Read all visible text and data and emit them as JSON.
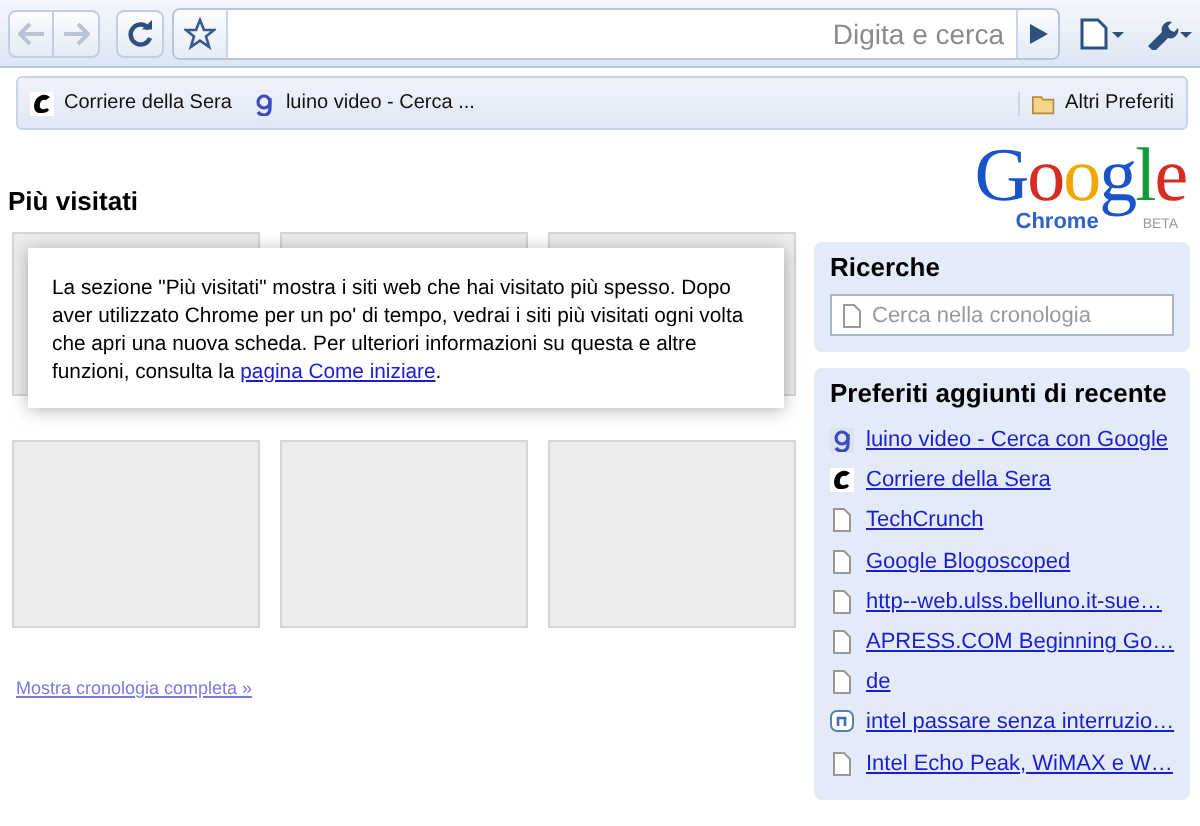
{
  "toolbar": {
    "back_disabled": true,
    "forward_disabled": true,
    "omnibox_placeholder": "Digita e cerca"
  },
  "bookmarks_bar": {
    "items": [
      {
        "label": "Corriere della Sera",
        "kind": "corriere"
      },
      {
        "label": "luino video - Cerca ...",
        "kind": "google"
      }
    ],
    "other": "Altri Preferiti"
  },
  "most_visited": {
    "title": "Più visitati",
    "notice": "La sezione \"Più visitati\" mostra i siti web che hai visitato più spesso. Dopo aver utilizzato Chrome per un po' di tempo, vedrai i siti più visitati ogni volta che apri una nuova scheda. Per ulteriori informazioni su questa e altre funzioni, consulta la",
    "notice_link": "pagina Come iniziare",
    "notice_end": ".",
    "history_link": "Mostra cronologia completa »"
  },
  "logo": {
    "word": "Google",
    "product": "Chrome",
    "badge": "BETA"
  },
  "searches": {
    "title": "Ricerche",
    "placeholder": "Cerca nella cronologia"
  },
  "recent_bookmarks": {
    "title": "Preferiti aggiunti di recente",
    "items": [
      {
        "label": "luino video - Cerca con Google",
        "kind": "google"
      },
      {
        "label": "Corriere della Sera",
        "kind": "corriere"
      },
      {
        "label": "TechCrunch",
        "kind": "page"
      },
      {
        "label": "Google Blogoscoped",
        "kind": "page"
      },
      {
        "label": "http--web.ulss.belluno.it-sue…",
        "kind": "page"
      },
      {
        "label": "APRESS.COM Beginning Go…",
        "kind": "page"
      },
      {
        "label": "de",
        "kind": "page"
      },
      {
        "label": "intel passare senza interruzio…",
        "kind": "n"
      },
      {
        "label": "Intel Echo Peak, WiMAX e W…",
        "kind": "page"
      }
    ]
  }
}
